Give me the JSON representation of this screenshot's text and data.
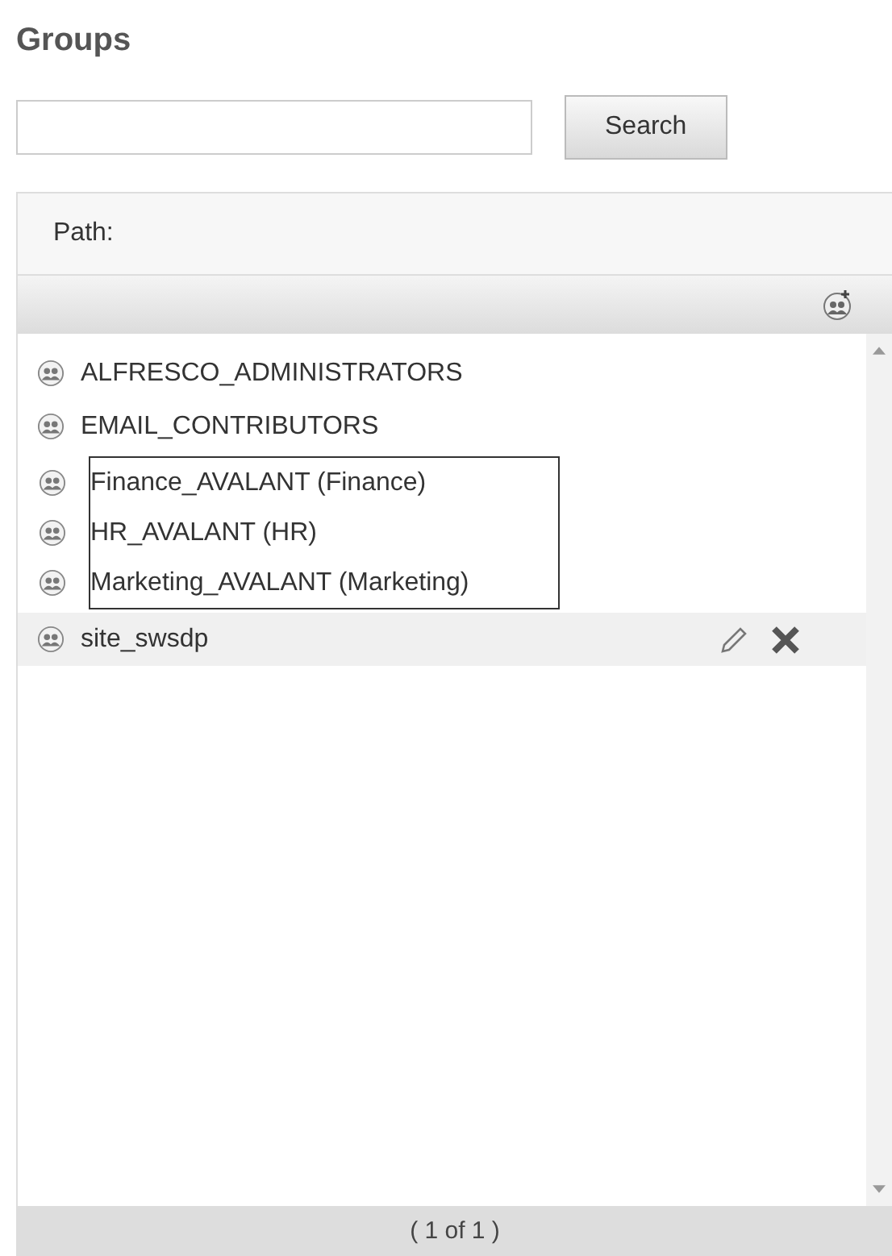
{
  "title": "Groups",
  "search": {
    "button": "Search"
  },
  "path": {
    "label": "Path:"
  },
  "groups": [
    {
      "name": "ALFRESCO_ADMINISTRATORS",
      "selected": false,
      "boxed": false
    },
    {
      "name": "EMAIL_CONTRIBUTORS",
      "selected": false,
      "boxed": false
    },
    {
      "name": "Finance_AVALANT (Finance)",
      "selected": false,
      "boxed": true
    },
    {
      "name": "HR_AVALANT (HR)",
      "selected": false,
      "boxed": true
    },
    {
      "name": "Marketing_AVALANT (Marketing)",
      "selected": false,
      "boxed": true
    },
    {
      "name": "site_swsdp",
      "selected": true,
      "boxed": false
    }
  ],
  "pager": "( 1 of 1 )"
}
